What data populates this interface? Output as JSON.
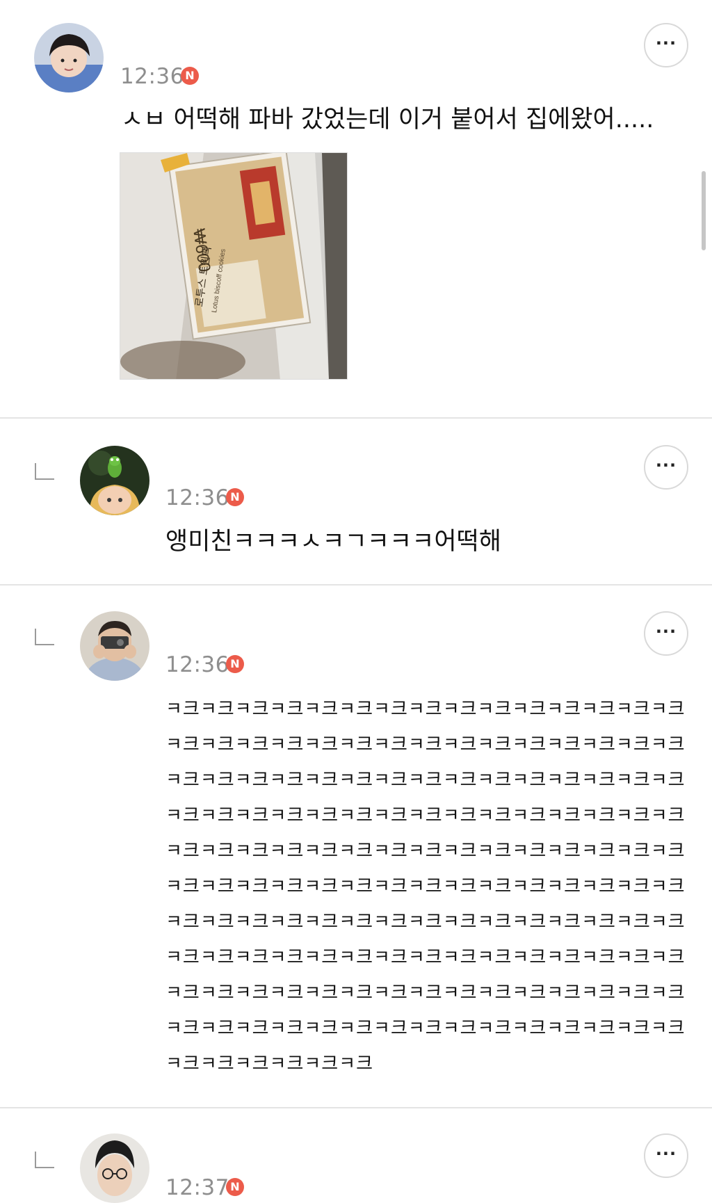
{
  "comments": [
    {
      "time": "12:36",
      "badge": "N",
      "text": "ㅅㅂ 어떡해 파바 갔었는데 이거 붙어서 집에왔어.....",
      "more_label": "···",
      "photo": {
        "price_label": "₩600",
        "product_name": "로투스 트윈팩",
        "product_sub": "Lotus biscoff cookies"
      }
    },
    {
      "time": "12:36",
      "badge": "N",
      "text": "앵미친ㅋㅋㅋㅅㅋㄱㅋㅋㅋ어떡해",
      "more_label": "···"
    },
    {
      "time": "12:36",
      "badge": "N",
      "more_label": "···",
      "laugh_lines": [
        "ㅋ크ㅋ크ㅋ크ㅋ크ㅋ크ㅋ크ㅋ크ㅋ크ㅋ크ㅋ크ㅋ크ㅋ크ㅋ크ㅋ크ㅋ크",
        "ㅋ크ㅋ크ㅋ크ㅋ크ㅋ크ㅋ크ㅋ크ㅋ크ㅋ크ㅋ크ㅋ크ㅋ크ㅋ크ㅋ크ㅋ크",
        "ㅋ크ㅋ크ㅋ크ㅋ크ㅋ크ㅋ크ㅋ크ㅋ크ㅋ크ㅋ크ㅋ크ㅋ크ㅋ크ㅋ크ㅋ크",
        "ㅋ크ㅋ크ㅋ크ㅋ크ㅋ크ㅋ크ㅋ크ㅋ크ㅋ크ㅋ크ㅋ크ㅋ크ㅋ크ㅋ크ㅋ크",
        "ㅋ크ㅋ크ㅋ크ㅋ크ㅋ크ㅋ크ㅋ크ㅋ크ㅋ크ㅋ크ㅋ크ㅋ크ㅋ크ㅋ크ㅋ크",
        "ㅋ크ㅋ크ㅋ크ㅋ크ㅋ크ㅋ크ㅋ크ㅋ크ㅋ크ㅋ크ㅋ크ㅋ크ㅋ크ㅋ크ㅋ크",
        "ㅋ크ㅋ크ㅋ크ㅋ크ㅋ크ㅋ크ㅋ크ㅋ크ㅋ크ㅋ크ㅋ크ㅋ크ㅋ크ㅋ크ㅋ크",
        "ㅋ크ㅋ크ㅋ크ㅋ크ㅋ크ㅋ크ㅋ크ㅋ크ㅋ크ㅋ크ㅋ크ㅋ크ㅋ크ㅋ크ㅋ크",
        "ㅋ크ㅋ크ㅋ크ㅋ크ㅋ크ㅋ크ㅋ크ㅋ크ㅋ크ㅋ크ㅋ크ㅋ크ㅋ크ㅋ크ㅋ크",
        "ㅋ크ㅋ크ㅋ크ㅋ크ㅋ크ㅋ크ㅋ크ㅋ크ㅋ크ㅋ크ㅋ크ㅋ크ㅋ크ㅋ크ㅋ크",
        "ㅋ크ㅋ크ㅋ크ㅋ크ㅋ크ㅋ크"
      ]
    },
    {
      "time": "12:37",
      "badge": "N",
      "more_label": "···"
    }
  ],
  "colors": {
    "badge": "#ec5b4a",
    "timestamp": "#8e8e8e",
    "divider": "#e4e4e4",
    "text": "#111111"
  },
  "icons": {
    "reply": "reply-corner-icon",
    "more": "more-dots-icon",
    "new": "new-badge-icon"
  }
}
